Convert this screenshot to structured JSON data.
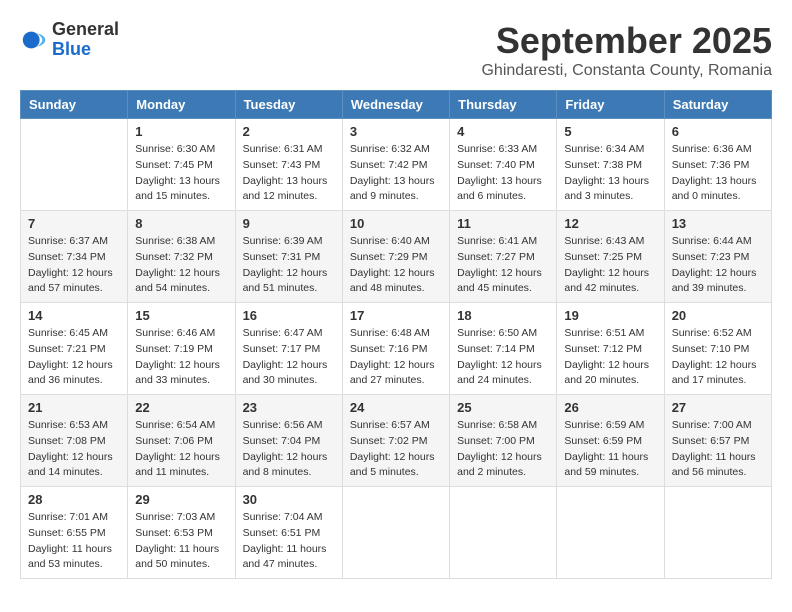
{
  "logo": {
    "general": "General",
    "blue": "Blue"
  },
  "title": "September 2025",
  "subtitle": "Ghindaresti, Constanta County, Romania",
  "weekdays": [
    "Sunday",
    "Monday",
    "Tuesday",
    "Wednesday",
    "Thursday",
    "Friday",
    "Saturday"
  ],
  "weeks": [
    [
      {
        "day": "",
        "info": ""
      },
      {
        "day": "1",
        "info": "Sunrise: 6:30 AM\nSunset: 7:45 PM\nDaylight: 13 hours\nand 15 minutes."
      },
      {
        "day": "2",
        "info": "Sunrise: 6:31 AM\nSunset: 7:43 PM\nDaylight: 13 hours\nand 12 minutes."
      },
      {
        "day": "3",
        "info": "Sunrise: 6:32 AM\nSunset: 7:42 PM\nDaylight: 13 hours\nand 9 minutes."
      },
      {
        "day": "4",
        "info": "Sunrise: 6:33 AM\nSunset: 7:40 PM\nDaylight: 13 hours\nand 6 minutes."
      },
      {
        "day": "5",
        "info": "Sunrise: 6:34 AM\nSunset: 7:38 PM\nDaylight: 13 hours\nand 3 minutes."
      },
      {
        "day": "6",
        "info": "Sunrise: 6:36 AM\nSunset: 7:36 PM\nDaylight: 13 hours\nand 0 minutes."
      }
    ],
    [
      {
        "day": "7",
        "info": "Sunrise: 6:37 AM\nSunset: 7:34 PM\nDaylight: 12 hours\nand 57 minutes."
      },
      {
        "day": "8",
        "info": "Sunrise: 6:38 AM\nSunset: 7:32 PM\nDaylight: 12 hours\nand 54 minutes."
      },
      {
        "day": "9",
        "info": "Sunrise: 6:39 AM\nSunset: 7:31 PM\nDaylight: 12 hours\nand 51 minutes."
      },
      {
        "day": "10",
        "info": "Sunrise: 6:40 AM\nSunset: 7:29 PM\nDaylight: 12 hours\nand 48 minutes."
      },
      {
        "day": "11",
        "info": "Sunrise: 6:41 AM\nSunset: 7:27 PM\nDaylight: 12 hours\nand 45 minutes."
      },
      {
        "day": "12",
        "info": "Sunrise: 6:43 AM\nSunset: 7:25 PM\nDaylight: 12 hours\nand 42 minutes."
      },
      {
        "day": "13",
        "info": "Sunrise: 6:44 AM\nSunset: 7:23 PM\nDaylight: 12 hours\nand 39 minutes."
      }
    ],
    [
      {
        "day": "14",
        "info": "Sunrise: 6:45 AM\nSunset: 7:21 PM\nDaylight: 12 hours\nand 36 minutes."
      },
      {
        "day": "15",
        "info": "Sunrise: 6:46 AM\nSunset: 7:19 PM\nDaylight: 12 hours\nand 33 minutes."
      },
      {
        "day": "16",
        "info": "Sunrise: 6:47 AM\nSunset: 7:17 PM\nDaylight: 12 hours\nand 30 minutes."
      },
      {
        "day": "17",
        "info": "Sunrise: 6:48 AM\nSunset: 7:16 PM\nDaylight: 12 hours\nand 27 minutes."
      },
      {
        "day": "18",
        "info": "Sunrise: 6:50 AM\nSunset: 7:14 PM\nDaylight: 12 hours\nand 24 minutes."
      },
      {
        "day": "19",
        "info": "Sunrise: 6:51 AM\nSunset: 7:12 PM\nDaylight: 12 hours\nand 20 minutes."
      },
      {
        "day": "20",
        "info": "Sunrise: 6:52 AM\nSunset: 7:10 PM\nDaylight: 12 hours\nand 17 minutes."
      }
    ],
    [
      {
        "day": "21",
        "info": "Sunrise: 6:53 AM\nSunset: 7:08 PM\nDaylight: 12 hours\nand 14 minutes."
      },
      {
        "day": "22",
        "info": "Sunrise: 6:54 AM\nSunset: 7:06 PM\nDaylight: 12 hours\nand 11 minutes."
      },
      {
        "day": "23",
        "info": "Sunrise: 6:56 AM\nSunset: 7:04 PM\nDaylight: 12 hours\nand 8 minutes."
      },
      {
        "day": "24",
        "info": "Sunrise: 6:57 AM\nSunset: 7:02 PM\nDaylight: 12 hours\nand 5 minutes."
      },
      {
        "day": "25",
        "info": "Sunrise: 6:58 AM\nSunset: 7:00 PM\nDaylight: 12 hours\nand 2 minutes."
      },
      {
        "day": "26",
        "info": "Sunrise: 6:59 AM\nSunset: 6:59 PM\nDaylight: 11 hours\nand 59 minutes."
      },
      {
        "day": "27",
        "info": "Sunrise: 7:00 AM\nSunset: 6:57 PM\nDaylight: 11 hours\nand 56 minutes."
      }
    ],
    [
      {
        "day": "28",
        "info": "Sunrise: 7:01 AM\nSunset: 6:55 PM\nDaylight: 11 hours\nand 53 minutes."
      },
      {
        "day": "29",
        "info": "Sunrise: 7:03 AM\nSunset: 6:53 PM\nDaylight: 11 hours\nand 50 minutes."
      },
      {
        "day": "30",
        "info": "Sunrise: 7:04 AM\nSunset: 6:51 PM\nDaylight: 11 hours\nand 47 minutes."
      },
      {
        "day": "",
        "info": ""
      },
      {
        "day": "",
        "info": ""
      },
      {
        "day": "",
        "info": ""
      },
      {
        "day": "",
        "info": ""
      }
    ]
  ]
}
